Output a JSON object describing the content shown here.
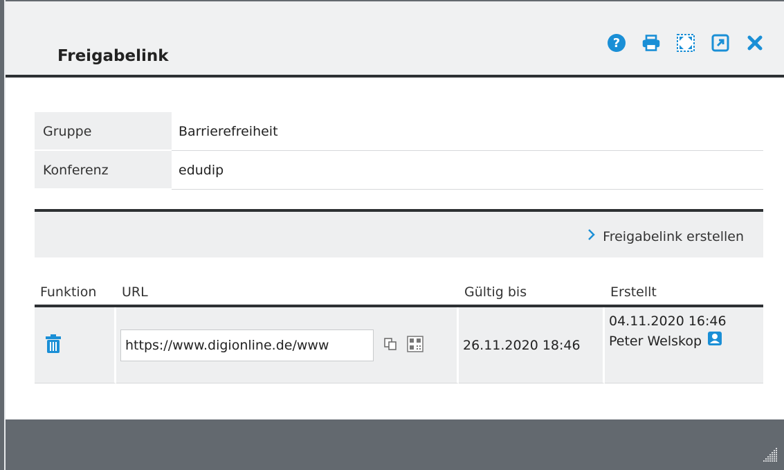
{
  "dialog": {
    "title": "Freigabelink",
    "icons": [
      "help-icon",
      "print-icon",
      "maximize-icon",
      "open-external-icon",
      "close-icon"
    ],
    "accent": "#1a8fd6"
  },
  "info": [
    {
      "key": "Gruppe",
      "value": "Barrierefreiheit"
    },
    {
      "key": "Konferenz",
      "value": "edudip"
    }
  ],
  "action": {
    "label": "Freigabelink erstellen"
  },
  "table": {
    "headers": [
      "Funktion",
      "URL",
      "Gültig bis",
      "Erstellt"
    ],
    "rows": [
      {
        "url": "https://www.digionline.de/www",
        "valid_until": "26.11.2020 18:46",
        "created_date": "04.11.2020 16:46",
        "created_by": "Peter Welskop"
      }
    ]
  }
}
